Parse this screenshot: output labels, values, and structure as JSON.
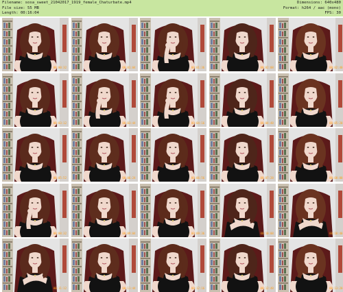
{
  "header": {
    "filename_label": "Filename: sosa_sweet_21042017_1919_female_Chaturbate.mp4",
    "filesize_label": "File size: 55 MB",
    "length_label": "Length: 00:16:04",
    "dimensions_label": "Dimensions: 640x480",
    "format_label": "Format: h264 / aac (mono)",
    "fps_label": "FPS: 30",
    "background_color": "#c8e6a0"
  },
  "thumbnails": [
    {
      "timestamp": "00:00:32",
      "pose": "normal",
      "hair": "#5a2a1c"
    },
    {
      "timestamp": "00:01:04",
      "pose": "normal",
      "hair": "#5e2d1d"
    },
    {
      "timestamp": "00:01:36",
      "pose": "hand",
      "hair": "#5c2b1b"
    },
    {
      "timestamp": "00:02:08",
      "pose": "normal",
      "hair": "#4e251a"
    },
    {
      "timestamp": "00:02:40",
      "pose": "normal",
      "hair": "#6a3320"
    },
    {
      "timestamp": "00:03:12",
      "pose": "normal",
      "hair": "#5a2a1c"
    },
    {
      "timestamp": "00:03:44",
      "pose": "hand",
      "hair": "#5e2d1d"
    },
    {
      "timestamp": "00:04:16",
      "pose": "hand",
      "hair": "#5c2b1b"
    },
    {
      "timestamp": "00:04:48",
      "pose": "normal",
      "hair": "#4e251a"
    },
    {
      "timestamp": "00:05:20",
      "pose": "normal",
      "hair": "#6a3320"
    },
    {
      "timestamp": "00:05:52",
      "pose": "normal",
      "hair": "#5a2a1c"
    },
    {
      "timestamp": "00:06:24",
      "pose": "normal",
      "hair": "#5e2d1d"
    },
    {
      "timestamp": "00:06:56",
      "pose": "normal",
      "hair": "#5c2b1b"
    },
    {
      "timestamp": "00:07:28",
      "pose": "normal",
      "hair": "#4e251a"
    },
    {
      "timestamp": "00:08:00",
      "pose": "normal",
      "hair": "#6a3320"
    },
    {
      "timestamp": "00:08:32",
      "pose": "hand",
      "hair": "#5a2a1c"
    },
    {
      "timestamp": "00:09:04",
      "pose": "normal",
      "hair": "#5e2d1d"
    },
    {
      "timestamp": "00:09:36",
      "pose": "normal",
      "hair": "#5c2b1b"
    },
    {
      "timestamp": "00:10:08",
      "pose": "arms",
      "hair": "#4e251a"
    },
    {
      "timestamp": "00:10:40",
      "pose": "arms",
      "hair": "#6a3320"
    },
    {
      "timestamp": "00:11:12",
      "pose": "arms",
      "hair": "#5a2a1c"
    },
    {
      "timestamp": "00:11:44",
      "pose": "normal",
      "hair": "#5e2d1d"
    },
    {
      "timestamp": "00:12:16",
      "pose": "normal",
      "hair": "#5c2b1b"
    },
    {
      "timestamp": "00:12:48",
      "pose": "normal",
      "hair": "#4e251a"
    },
    {
      "timestamp": "00:13:20",
      "pose": "normal",
      "hair": "#6a3320"
    }
  ],
  "scene_colors": {
    "wall": "#e4e4e4",
    "bookshelf": "#c9c0b0",
    "chair": "#5c1a1a",
    "skin": "#f0d8cc",
    "top": "#121212",
    "timestamp": "#ff9f1a"
  }
}
